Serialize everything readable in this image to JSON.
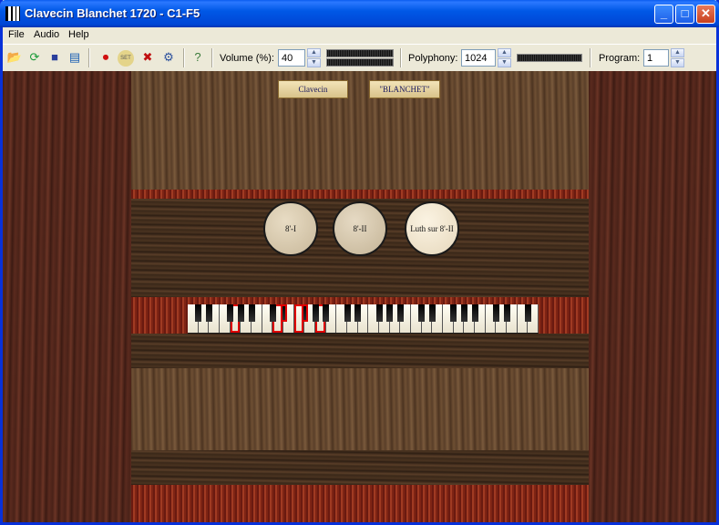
{
  "window": {
    "title": "Clavecin Blanchet 1720 - C1-F5"
  },
  "menu": [
    "File",
    "Audio",
    "Help"
  ],
  "toolbar": {
    "volume_label": "Volume (%):",
    "volume_value": "40",
    "polyphony_label": "Polyphony:",
    "polyphony_value": "1024",
    "program_label": "Program:",
    "program_value": "1",
    "set_icon_text": "SET"
  },
  "plaques": [
    "Clavecin",
    "\"BLANCHET\""
  ],
  "stops": [
    {
      "label": "8'-I",
      "active": false
    },
    {
      "label": "8'-II",
      "active": false
    },
    {
      "label": "Luth sur 8'-II",
      "active": true
    }
  ],
  "keyboard": {
    "white_key_count": 33,
    "pressed_white": [
      4,
      8,
      10,
      12
    ],
    "pressed_black": [
      6,
      7
    ]
  }
}
